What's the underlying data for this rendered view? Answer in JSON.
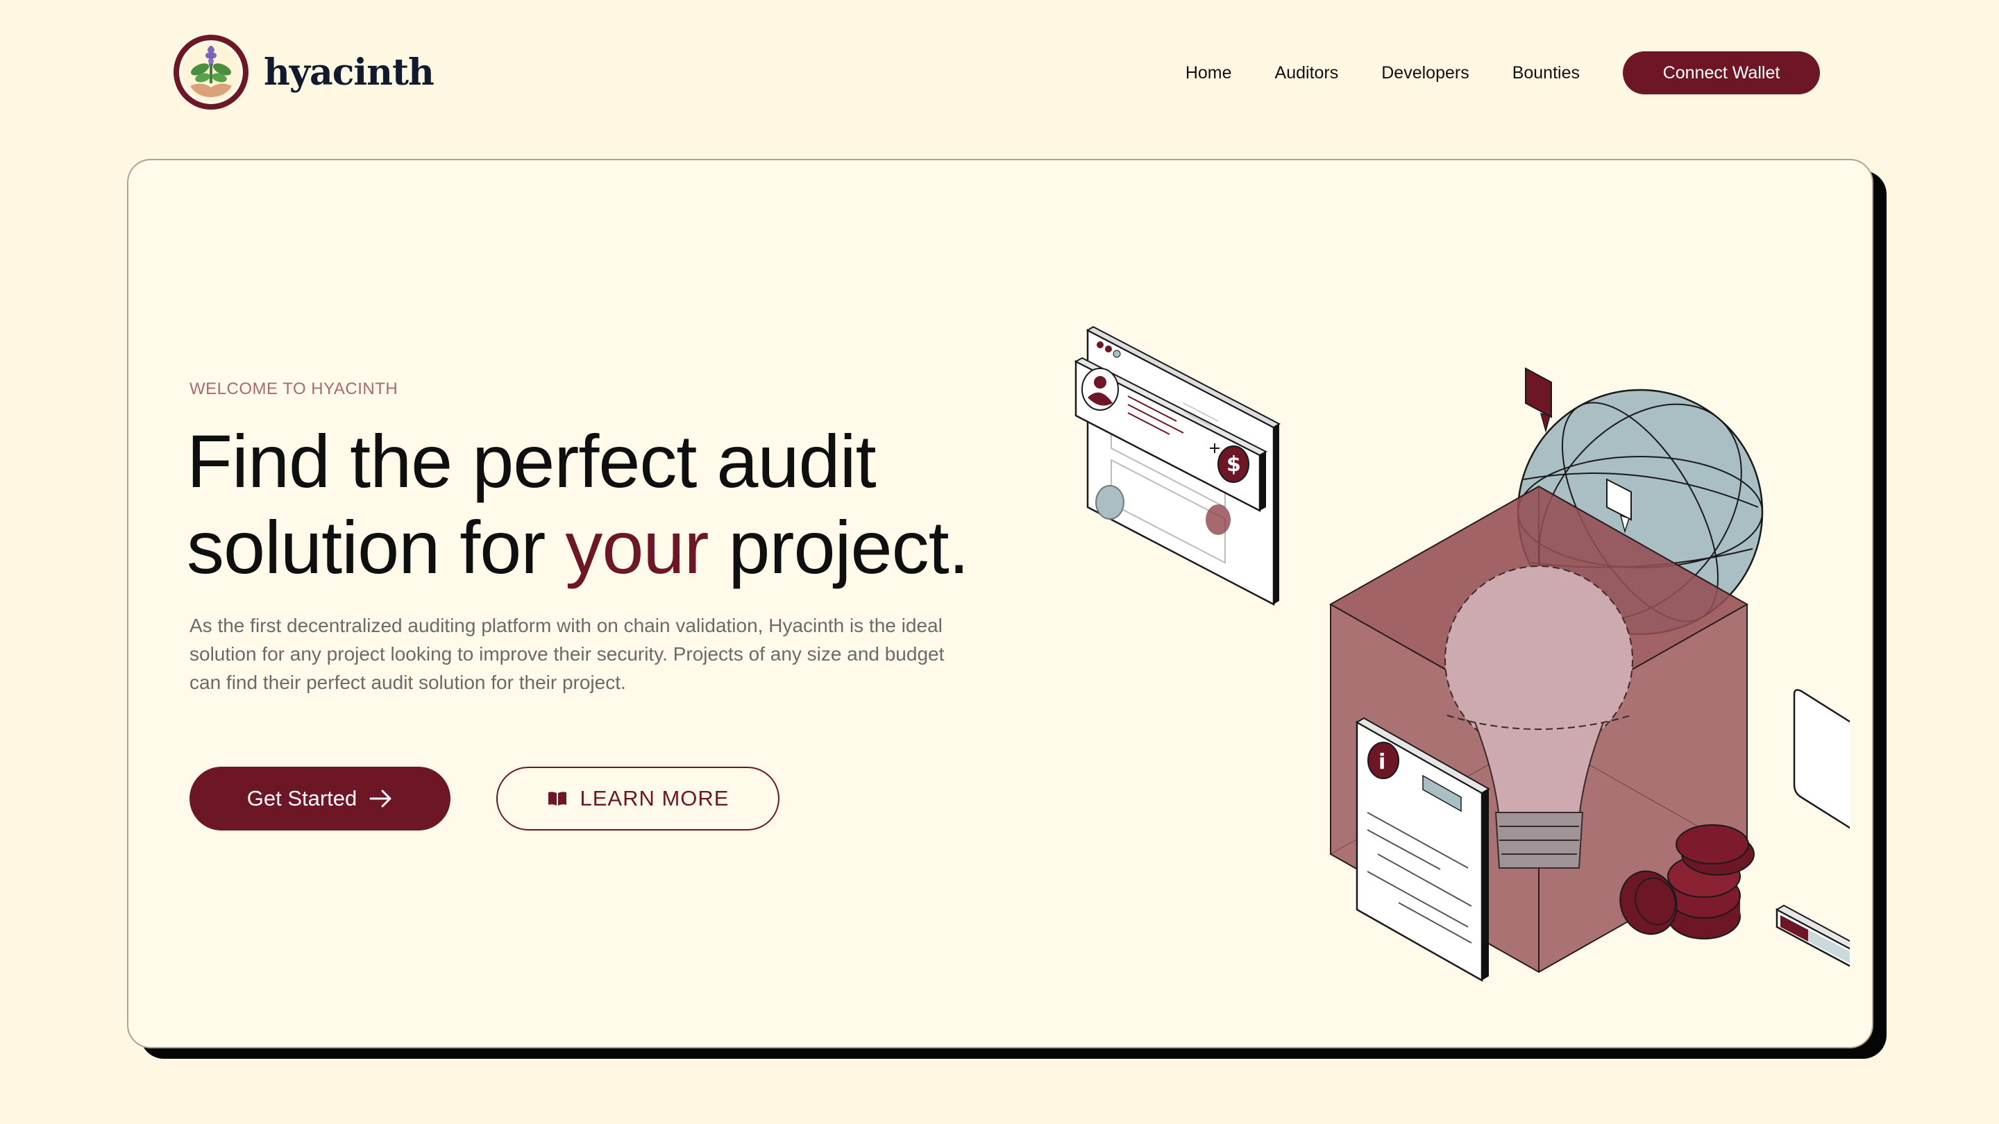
{
  "brand": {
    "name": "hyacinth"
  },
  "nav": {
    "links": [
      "Home",
      "Auditors",
      "Developers",
      "Bounties"
    ],
    "cta_label": "Connect Wallet"
  },
  "hero": {
    "eyebrow": "WELCOME TO HYACINTH",
    "headline_part1": "Find the perfect audit solution for ",
    "headline_accent": "your",
    "headline_part2": " project.",
    "description": "As the first decentralized auditing platform with on chain validation, Hyacinth is the ideal solution for any project looking to improve their security. Projects of any size and budget can find their perfect audit solution for their project.",
    "primary_cta": "Get Started",
    "secondary_cta": "LEARN MORE"
  },
  "colors": {
    "background": "#fef8e3",
    "card": "#fffaea",
    "accent": "#6d1625",
    "globe": "#a9bfc4",
    "cube": "#8e444b"
  },
  "icons": {
    "primary_cta": "arrow-right-icon",
    "secondary_cta": "book-open-icon",
    "logo": "hyacinth-logo-icon"
  }
}
